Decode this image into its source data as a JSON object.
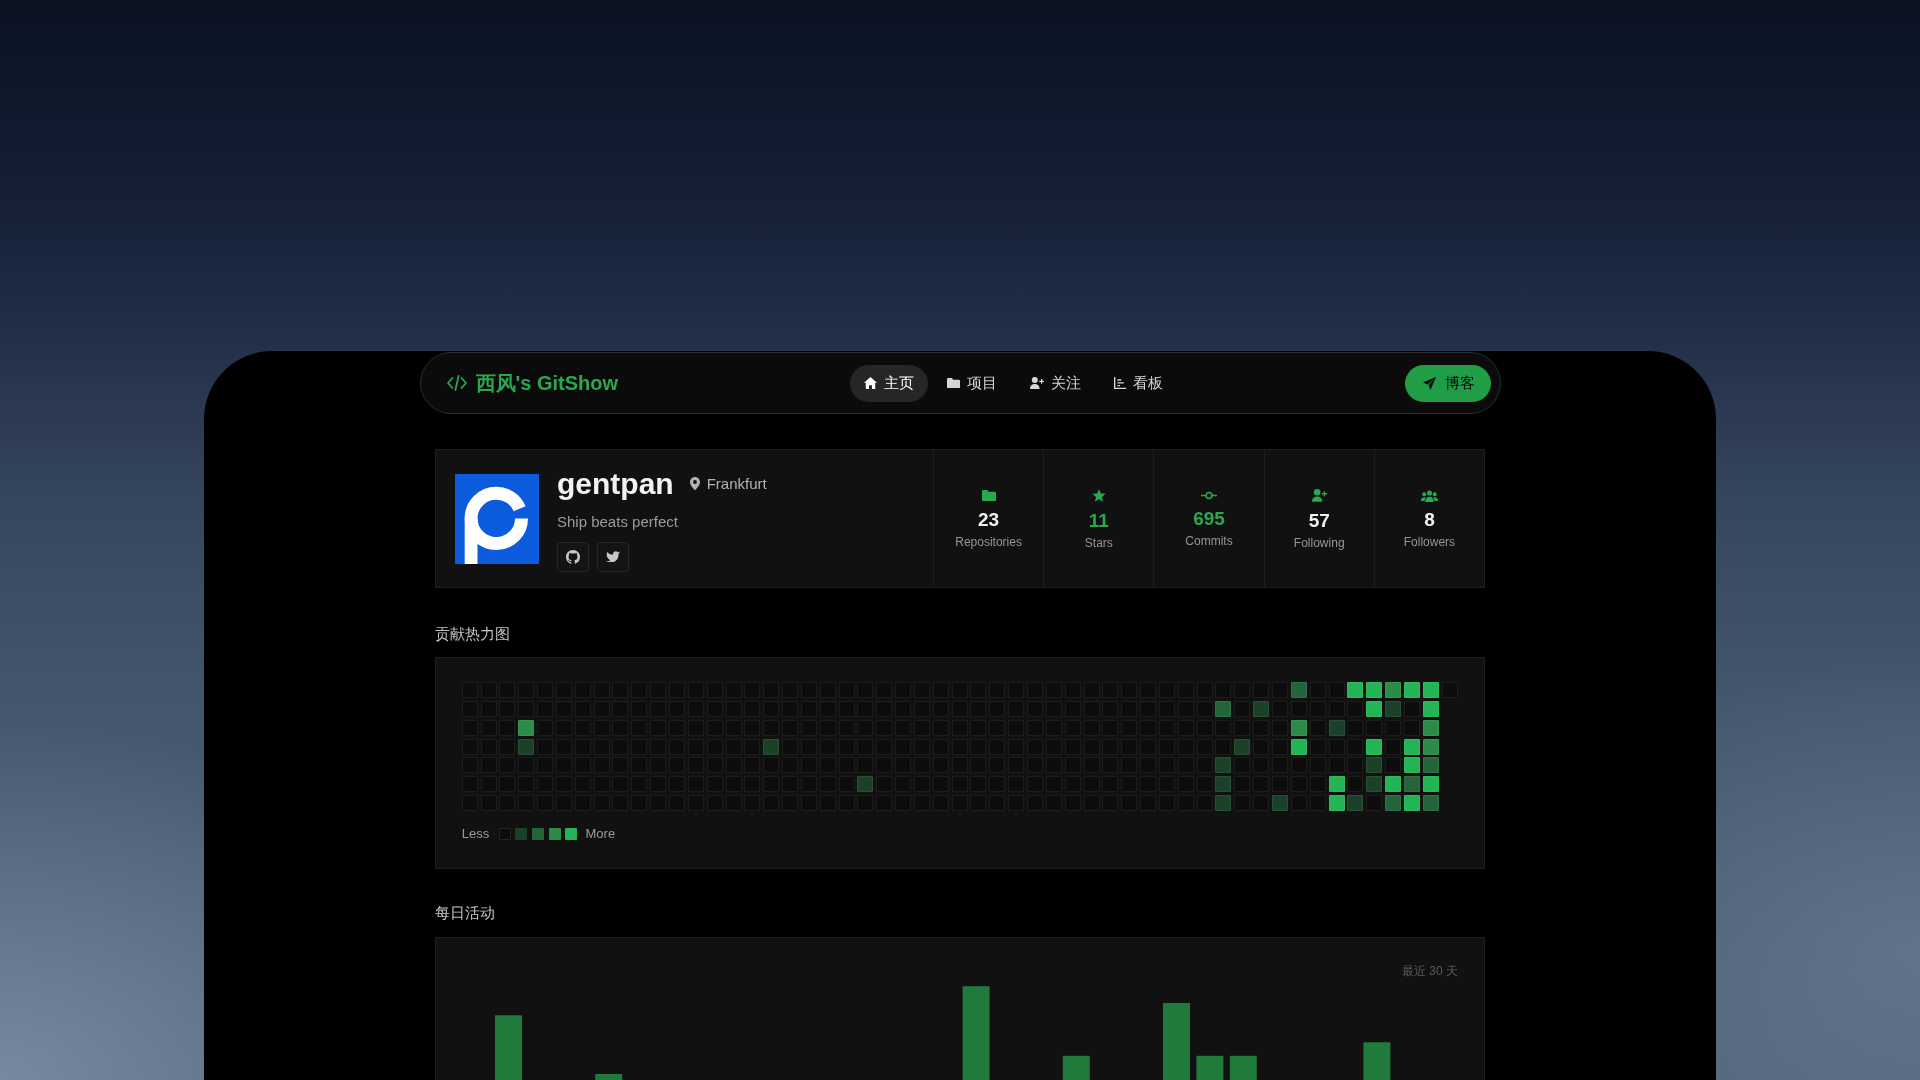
{
  "nav": {
    "logo": "西风's GitShow",
    "tabs": [
      {
        "label": "主页",
        "selected": true
      },
      {
        "label": "项目",
        "selected": false
      },
      {
        "label": "关注",
        "selected": false
      },
      {
        "label": "看板",
        "selected": false
      }
    ],
    "action": {
      "label": "博客"
    }
  },
  "profile": {
    "username": "gentpan",
    "location": "Frankfurt",
    "bio": "Ship beats perfect"
  },
  "stats": [
    {
      "value": "23",
      "label": "Repositories",
      "highlighted": false
    },
    {
      "value": "11",
      "label": "Stars",
      "highlighted": true
    },
    {
      "value": "695",
      "label": "Commits",
      "highlighted": true
    },
    {
      "value": "57",
      "label": "Following",
      "highlighted": false
    },
    {
      "value": "8",
      "label": "Followers",
      "highlighted": false
    }
  ],
  "contributions": {
    "title": "贡献热力图",
    "weeks": [
      [
        {
          "color": "#0c0c0c"
        },
        {
          "color": "#0c0c0c"
        },
        {
          "color": "#0c0c0c"
        },
        {
          "color": "#0c0c0c"
        },
        {
          "color": "#0c0c0c"
        },
        {
          "color": "#0c0c0c"
        },
        {
          "color": "#0c0c0c"
        }
      ],
      [
        {
          "color": "#0c0c0c"
        },
        {
          "color": "#0c0c0c"
        },
        {
          "color": "#0c0c0c"
        },
        {
          "color": "#0c0c0c"
        },
        {
          "color": "#0c0c0c"
        },
        {
          "color": "#0c0c0c"
        },
        {
          "color": "#0c0c0c"
        }
      ],
      [
        {
          "color": "#0c0c0c"
        },
        {
          "color": "#0c0c0c"
        },
        {
          "color": "#0c0c0c"
        },
        {
          "color": "#0c0c0c"
        },
        {
          "color": "#0c0c0c"
        },
        {
          "color": "#0c0c0c"
        },
        {
          "color": "#0c0c0c"
        }
      ],
      [
        {
          "color": "#0c0c0c"
        },
        {
          "color": "#0c0c0c"
        },
        {
          "color": "#2b8c4a"
        },
        {
          "color": "#1b4128"
        },
        {
          "color": "#0c0c0c"
        },
        {
          "color": "#0c0c0c"
        },
        {
          "color": "#0c0c0c"
        }
      ],
      [
        {
          "color": "#0c0c0c"
        },
        {
          "color": "#0c0c0c"
        },
        {
          "color": "#0c0c0c"
        },
        {
          "color": "#0c0c0c"
        },
        {
          "color": "#0c0c0c"
        },
        {
          "color": "#0c0c0c"
        },
        {
          "color": "#0c0c0c"
        }
      ],
      [
        {
          "color": "#0c0c0c"
        },
        {
          "color": "#0c0c0c"
        },
        {
          "color": "#0c0c0c"
        },
        {
          "color": "#0c0c0c"
        },
        {
          "color": "#0c0c0c"
        },
        {
          "color": "#0c0c0c"
        },
        {
          "color": "#0c0c0c"
        }
      ],
      [
        {
          "color": "#0c0c0c"
        },
        {
          "color": "#0c0c0c"
        },
        {
          "color": "#0c0c0c"
        },
        {
          "color": "#0c0c0c"
        },
        {
          "color": "#0c0c0c"
        },
        {
          "color": "#0c0c0c"
        },
        {
          "color": "#0c0c0c"
        }
      ],
      [
        {
          "color": "#0c0c0c"
        },
        {
          "color": "#0c0c0c"
        },
        {
          "color": "#0c0c0c"
        },
        {
          "color": "#0c0c0c"
        },
        {
          "color": "#0c0c0c"
        },
        {
          "color": "#0c0c0c"
        },
        {
          "color": "#0c0c0c"
        }
      ],
      [
        {
          "color": "#0c0c0c"
        },
        {
          "color": "#0c0c0c"
        },
        {
          "color": "#0c0c0c"
        },
        {
          "color": "#0c0c0c"
        },
        {
          "color": "#0c0c0c"
        },
        {
          "color": "#0c0c0c"
        },
        {
          "color": "#0c0c0c"
        }
      ],
      [
        {
          "color": "#0c0c0c"
        },
        {
          "color": "#0c0c0c"
        },
        {
          "color": "#0c0c0c"
        },
        {
          "color": "#0c0c0c"
        },
        {
          "color": "#0c0c0c"
        },
        {
          "color": "#0c0c0c"
        },
        {
          "color": "#0c0c0c"
        }
      ],
      [
        {
          "color": "#0c0c0c"
        },
        {
          "color": "#0c0c0c"
        },
        {
          "color": "#0c0c0c"
        },
        {
          "color": "#0c0c0c"
        },
        {
          "color": "#0c0c0c"
        },
        {
          "color": "#0c0c0c"
        },
        {
          "color": "#0c0c0c"
        }
      ],
      [
        {
          "color": "#0c0c0c"
        },
        {
          "color": "#0c0c0c"
        },
        {
          "color": "#0c0c0c"
        },
        {
          "color": "#0c0c0c"
        },
        {
          "color": "#0c0c0c"
        },
        {
          "color": "#0c0c0c"
        },
        {
          "color": "#0c0c0c"
        }
      ],
      [
        {
          "color": "#0c0c0c"
        },
        {
          "color": "#0c0c0c"
        },
        {
          "color": "#0c0c0c"
        },
        {
          "color": "#0c0c0c"
        },
        {
          "color": "#0c0c0c"
        },
        {
          "color": "#0c0c0c"
        },
        {
          "color": "#0c0c0c"
        }
      ],
      [
        {
          "color": "#0c0c0c"
        },
        {
          "color": "#0c0c0c"
        },
        {
          "color": "#0c0c0c"
        },
        {
          "color": "#0c0c0c"
        },
        {
          "color": "#0c0c0c"
        },
        {
          "color": "#0c0c0c"
        },
        {
          "color": "#0c0c0c"
        }
      ],
      [
        {
          "color": "#0c0c0c"
        },
        {
          "color": "#0c0c0c"
        },
        {
          "color": "#0c0c0c"
        },
        {
          "color": "#0c0c0c"
        },
        {
          "color": "#0c0c0c"
        },
        {
          "color": "#0c0c0c"
        },
        {
          "color": "#0c0c0c"
        }
      ],
      [
        {
          "color": "#0c0c0c"
        },
        {
          "color": "#0c0c0c"
        },
        {
          "color": "#0c0c0c"
        },
        {
          "color": "#0c0c0c"
        },
        {
          "color": "#0c0c0c"
        },
        {
          "color": "#0c0c0c"
        },
        {
          "color": "#0c0c0c"
        }
      ],
      [
        {
          "color": "#0c0c0c"
        },
        {
          "color": "#0c0c0c"
        },
        {
          "color": "#0c0c0c"
        },
        {
          "color": "#1b4128"
        },
        {
          "color": "#0c0c0c"
        },
        {
          "color": "#0c0c0c"
        },
        {
          "color": "#0c0c0c"
        }
      ],
      [
        {
          "color": "#0c0c0c"
        },
        {
          "color": "#0c0c0c"
        },
        {
          "color": "#0c0c0c"
        },
        {
          "color": "#0c0c0c"
        },
        {
          "color": "#0c0c0c"
        },
        {
          "color": "#0c0c0c"
        },
        {
          "color": "#0c0c0c"
        }
      ],
      [
        {
          "color": "#0c0c0c"
        },
        {
          "color": "#0c0c0c"
        },
        {
          "color": "#0c0c0c"
        },
        {
          "color": "#0c0c0c"
        },
        {
          "color": "#0c0c0c"
        },
        {
          "color": "#0c0c0c"
        },
        {
          "color": "#0c0c0c"
        }
      ],
      [
        {
          "color": "#0c0c0c"
        },
        {
          "color": "#0c0c0c"
        },
        {
          "color": "#0c0c0c"
        },
        {
          "color": "#0c0c0c"
        },
        {
          "color": "#0c0c0c"
        },
        {
          "color": "#0c0c0c"
        },
        {
          "color": "#0c0c0c"
        }
      ],
      [
        {
          "color": "#0c0c0c"
        },
        {
          "color": "#0c0c0c"
        },
        {
          "color": "#0c0c0c"
        },
        {
          "color": "#0c0c0c"
        },
        {
          "color": "#0c0c0c"
        },
        {
          "color": "#0c0c0c"
        },
        {
          "color": "#0c0c0c"
        }
      ],
      [
        {
          "color": "#0c0c0c"
        },
        {
          "color": "#0c0c0c"
        },
        {
          "color": "#0c0c0c"
        },
        {
          "color": "#0c0c0c"
        },
        {
          "color": "#0c0c0c"
        },
        {
          "color": "#1b4128"
        },
        {
          "color": "#0c0c0c"
        }
      ],
      [
        {
          "color": "#0c0c0c"
        },
        {
          "color": "#0c0c0c"
        },
        {
          "color": "#0c0c0c"
        },
        {
          "color": "#0c0c0c"
        },
        {
          "color": "#0c0c0c"
        },
        {
          "color": "#0c0c0c"
        },
        {
          "color": "#0c0c0c"
        }
      ],
      [
        {
          "color": "#0c0c0c"
        },
        {
          "color": "#0c0c0c"
        },
        {
          "color": "#0c0c0c"
        },
        {
          "color": "#0c0c0c"
        },
        {
          "color": "#0c0c0c"
        },
        {
          "color": "#0c0c0c"
        },
        {
          "color": "#0c0c0c"
        }
      ],
      [
        {
          "color": "#0c0c0c"
        },
        {
          "color": "#0c0c0c"
        },
        {
          "color": "#0c0c0c"
        },
        {
          "color": "#0c0c0c"
        },
        {
          "color": "#0c0c0c"
        },
        {
          "color": "#0c0c0c"
        },
        {
          "color": "#0c0c0c"
        }
      ],
      [
        {
          "color": "#0c0c0c"
        },
        {
          "color": "#0c0c0c"
        },
        {
          "color": "#0c0c0c"
        },
        {
          "color": "#0c0c0c"
        },
        {
          "color": "#0c0c0c"
        },
        {
          "color": "#0c0c0c"
        },
        {
          "color": "#0c0c0c"
        }
      ],
      [
        {
          "color": "#0c0c0c"
        },
        {
          "color": "#0c0c0c"
        },
        {
          "color": "#0c0c0c"
        },
        {
          "color": "#0c0c0c"
        },
        {
          "color": "#0c0c0c"
        },
        {
          "color": "#0c0c0c"
        },
        {
          "color": "#0c0c0c"
        }
      ],
      [
        {
          "color": "#0c0c0c"
        },
        {
          "color": "#0c0c0c"
        },
        {
          "color": "#0c0c0c"
        },
        {
          "color": "#0c0c0c"
        },
        {
          "color": "#0c0c0c"
        },
        {
          "color": "#0c0c0c"
        },
        {
          "color": "#0c0c0c"
        }
      ],
      [
        {
          "color": "#0c0c0c"
        },
        {
          "color": "#0c0c0c"
        },
        {
          "color": "#0c0c0c"
        },
        {
          "color": "#0c0c0c"
        },
        {
          "color": "#0c0c0c"
        },
        {
          "color": "#0c0c0c"
        },
        {
          "color": "#0c0c0c"
        }
      ],
      [
        {
          "color": "#0c0c0c"
        },
        {
          "color": "#0c0c0c"
        },
        {
          "color": "#0c0c0c"
        },
        {
          "color": "#0c0c0c"
        },
        {
          "color": "#0c0c0c"
        },
        {
          "color": "#0c0c0c"
        },
        {
          "color": "#0c0c0c"
        }
      ],
      [
        {
          "color": "#0c0c0c"
        },
        {
          "color": "#0c0c0c"
        },
        {
          "color": "#0c0c0c"
        },
        {
          "color": "#0c0c0c"
        },
        {
          "color": "#0c0c0c"
        },
        {
          "color": "#0c0c0c"
        },
        {
          "color": "#0c0c0c"
        }
      ],
      [
        {
          "color": "#0c0c0c"
        },
        {
          "color": "#0c0c0c"
        },
        {
          "color": "#0c0c0c"
        },
        {
          "color": "#0c0c0c"
        },
        {
          "color": "#0c0c0c"
        },
        {
          "color": "#0c0c0c"
        },
        {
          "color": "#0c0c0c"
        }
      ],
      [
        {
          "color": "#0c0c0c"
        },
        {
          "color": "#0c0c0c"
        },
        {
          "color": "#0c0c0c"
        },
        {
          "color": "#0c0c0c"
        },
        {
          "color": "#0c0c0c"
        },
        {
          "color": "#0c0c0c"
        },
        {
          "color": "#0c0c0c"
        }
      ],
      [
        {
          "color": "#0c0c0c"
        },
        {
          "color": "#0c0c0c"
        },
        {
          "color": "#0c0c0c"
        },
        {
          "color": "#0c0c0c"
        },
        {
          "color": "#0c0c0c"
        },
        {
          "color": "#0c0c0c"
        },
        {
          "color": "#0c0c0c"
        }
      ],
      [
        {
          "color": "#0c0c0c"
        },
        {
          "color": "#0c0c0c"
        },
        {
          "color": "#0c0c0c"
        },
        {
          "color": "#0c0c0c"
        },
        {
          "color": "#0c0c0c"
        },
        {
          "color": "#0c0c0c"
        },
        {
          "color": "#0c0c0c"
        }
      ],
      [
        {
          "color": "#0c0c0c"
        },
        {
          "color": "#0c0c0c"
        },
        {
          "color": "#0c0c0c"
        },
        {
          "color": "#0c0c0c"
        },
        {
          "color": "#0c0c0c"
        },
        {
          "color": "#0c0c0c"
        },
        {
          "color": "#0c0c0c"
        }
      ],
      [
        {
          "color": "#0c0c0c"
        },
        {
          "color": "#0c0c0c"
        },
        {
          "color": "#0c0c0c"
        },
        {
          "color": "#0c0c0c"
        },
        {
          "color": "#0c0c0c"
        },
        {
          "color": "#0c0c0c"
        },
        {
          "color": "#0c0c0c"
        }
      ],
      [
        {
          "color": "#0c0c0c"
        },
        {
          "color": "#0c0c0c"
        },
        {
          "color": "#0c0c0c"
        },
        {
          "color": "#0c0c0c"
        },
        {
          "color": "#0c0c0c"
        },
        {
          "color": "#0c0c0c"
        },
        {
          "color": "#0c0c0c"
        }
      ],
      [
        {
          "color": "#0c0c0c"
        },
        {
          "color": "#0c0c0c"
        },
        {
          "color": "#0c0c0c"
        },
        {
          "color": "#0c0c0c"
        },
        {
          "color": "#0c0c0c"
        },
        {
          "color": "#0c0c0c"
        },
        {
          "color": "#0c0c0c"
        }
      ],
      [
        {
          "color": "#0c0c0c"
        },
        {
          "color": "#0c0c0c"
        },
        {
          "color": "#0c0c0c"
        },
        {
          "color": "#0c0c0c"
        },
        {
          "color": "#0c0c0c"
        },
        {
          "color": "#0c0c0c"
        },
        {
          "color": "#0c0c0c"
        }
      ],
      [
        {
          "color": "#0c0c0c"
        },
        {
          "color": "#23643a"
        },
        {
          "color": "#0c0c0c"
        },
        {
          "color": "#0c0c0c"
        },
        {
          "color": "#1b4128"
        },
        {
          "color": "#1b4128"
        },
        {
          "color": "#1b4128"
        }
      ],
      [
        {
          "color": "#0c0c0c"
        },
        {
          "color": "#0c0c0c"
        },
        {
          "color": "#0c0c0c"
        },
        {
          "color": "#1b4128"
        },
        {
          "color": "#0c0c0c"
        },
        {
          "color": "#0c0c0c"
        },
        {
          "color": "#0c0c0c"
        }
      ],
      [
        {
          "color": "#0c0c0c"
        },
        {
          "color": "#1b4128"
        },
        {
          "color": "#0c0c0c"
        },
        {
          "color": "#0c0c0c"
        },
        {
          "color": "#0c0c0c"
        },
        {
          "color": "#0c0c0c"
        },
        {
          "color": "#0c0c0c"
        }
      ],
      [
        {
          "color": "#0c0c0c"
        },
        {
          "color": "#0c0c0c"
        },
        {
          "color": "#0c0c0c"
        },
        {
          "color": "#0c0c0c"
        },
        {
          "color": "#0c0c0c"
        },
        {
          "color": "#0c0c0c"
        },
        {
          "color": "#1b4128"
        }
      ],
      [
        {
          "color": "#23643a"
        },
        {
          "color": "#0c0c0c"
        },
        {
          "color": "#2b8c4a"
        },
        {
          "color": "#22b455"
        },
        {
          "color": "#0c0c0c"
        },
        {
          "color": "#0c0c0c"
        },
        {
          "color": "#0c0c0c"
        }
      ],
      [
        {
          "color": "#0c0c0c"
        },
        {
          "color": "#0c0c0c"
        },
        {
          "color": "#0c0c0c"
        },
        {
          "color": "#0c0c0c"
        },
        {
          "color": "#0c0c0c"
        },
        {
          "color": "#0c0c0c"
        },
        {
          "color": "#0c0c0c"
        }
      ],
      [
        {
          "color": "#0c0c0c"
        },
        {
          "color": "#0c0c0c"
        },
        {
          "color": "#1b4128"
        },
        {
          "color": "#0c0c0c"
        },
        {
          "color": "#0c0c0c"
        },
        {
          "color": "#22b455"
        },
        {
          "color": "#22b455"
        }
      ],
      [
        {
          "color": "#22b455"
        },
        {
          "color": "#0c0c0c"
        },
        {
          "color": "#0c0c0c"
        },
        {
          "color": "#0c0c0c"
        },
        {
          "color": "#0c0c0c"
        },
        {
          "color": "#0c0c0c"
        },
        {
          "color": "#1b4128"
        }
      ],
      [
        {
          "color": "#22b455"
        },
        {
          "color": "#22b455"
        },
        {
          "color": "#0c0c0c"
        },
        {
          "color": "#22b455"
        },
        {
          "color": "#1b4128"
        },
        {
          "color": "#1b4128"
        },
        {
          "color": "#0c0c0c"
        }
      ],
      [
        {
          "color": "#2b8c4a"
        },
        {
          "color": "#1b4128"
        },
        {
          "color": "#0c0c0c"
        },
        {
          "color": "#0c0c0c"
        },
        {
          "color": "#0c0c0c"
        },
        {
          "color": "#22b455"
        },
        {
          "color": "#23643a"
        }
      ],
      [
        {
          "color": "#22b455"
        },
        {
          "color": "#0c0c0c"
        },
        {
          "color": "#0c0c0c"
        },
        {
          "color": "#22b455"
        },
        {
          "color": "#22b455"
        },
        {
          "color": "#23643a"
        },
        {
          "color": "#22b455"
        }
      ],
      [
        {
          "color": "#22b455"
        },
        {
          "color": "#22b455"
        },
        {
          "color": "#2b8c4a"
        },
        {
          "color": "#2b8c4a"
        },
        {
          "color": "#23643a"
        },
        {
          "color": "#22b455"
        },
        {
          "color": "#23643a"
        }
      ],
      [
        {
          "color": "#0c0c0c"
        }
      ]
    ],
    "legend": {
      "less": "Less",
      "more": "More"
    }
  },
  "daily_activity": {
    "title": "每日活动",
    "range_label": "最近 30 天"
  }
}
